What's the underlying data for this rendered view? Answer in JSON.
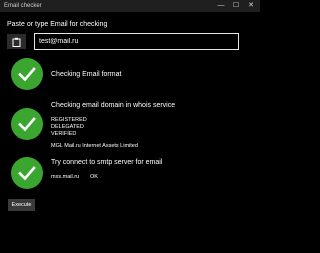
{
  "window": {
    "title": "Email checker",
    "controls": {
      "minimize": "—",
      "maximize": "☐",
      "close": "✕"
    }
  },
  "form": {
    "prompt": "Paste or type Email for checking",
    "email_value": "test@mail.ru",
    "paste_icon": "clipboard-icon"
  },
  "checks": {
    "format": {
      "title": "Checking Email format",
      "status": "success"
    },
    "domain": {
      "title": "Checking email domain in whois service",
      "status": "success",
      "flags": [
        "REGISTERED",
        "DELEGATED",
        "VERIFIED"
      ],
      "org": "MGL Mail.ru Internet Assets Limited"
    },
    "smtp": {
      "title": "Try connect to smtp server for email",
      "status": "success",
      "server": "mxs.mail.ru",
      "result": "OK"
    }
  },
  "actions": {
    "execute_label": "Execute"
  },
  "colors": {
    "background": "#000000",
    "success": "#3aa52f",
    "button": "#3a3a3a"
  }
}
